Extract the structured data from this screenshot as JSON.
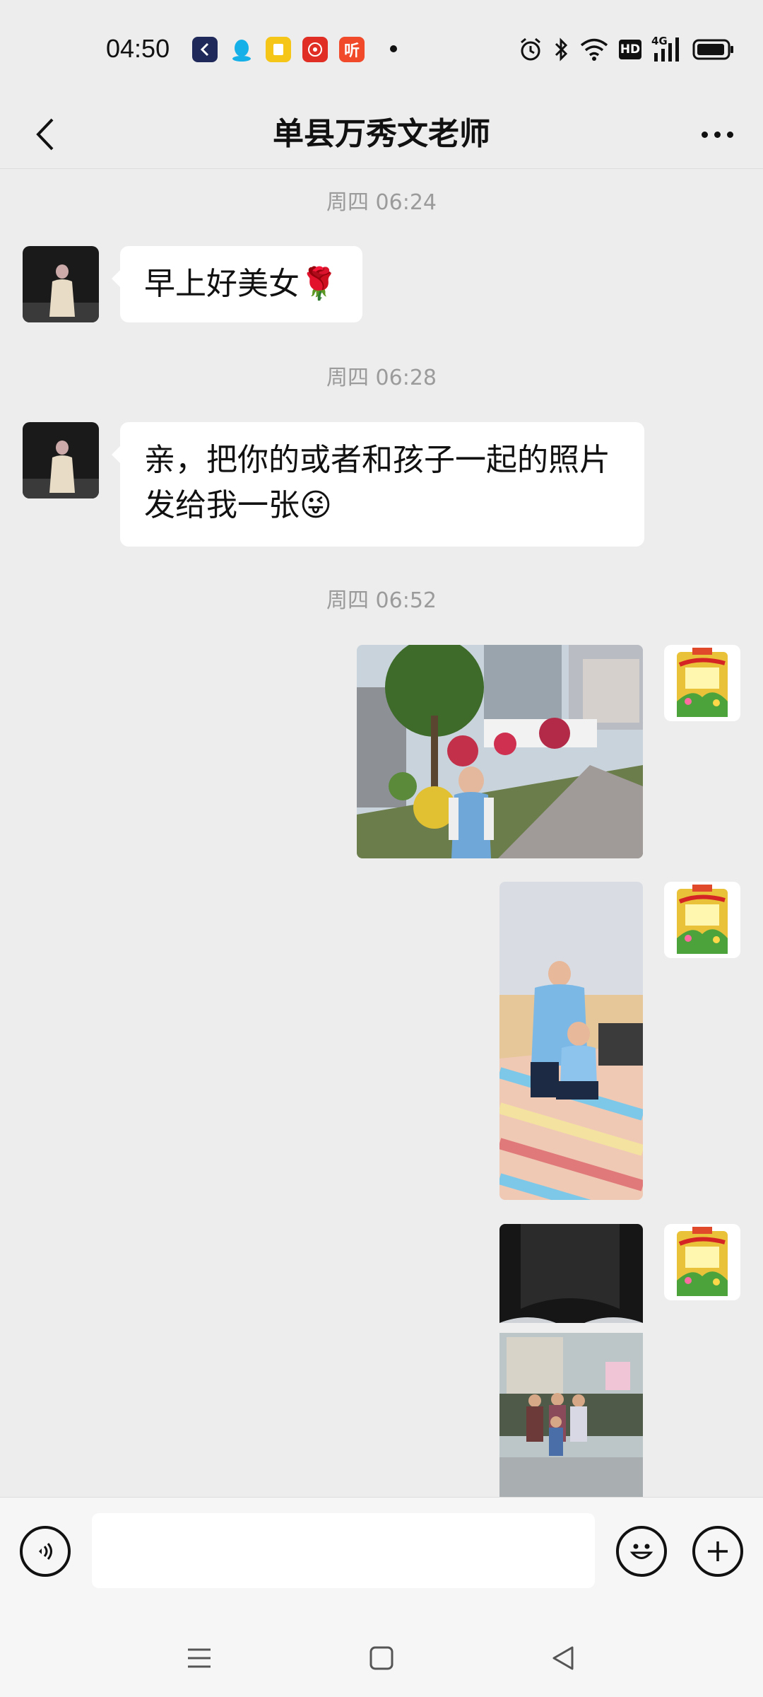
{
  "status_bar": {
    "time": "04:50",
    "notification_icons": [
      "back-app-icon",
      "qq-icon",
      "notes-app-icon",
      "pinduoduo-icon",
      "listen-app-icon"
    ],
    "listen_icon_text": "听",
    "system_icons": [
      "alarm-icon",
      "bluetooth-icon",
      "wifi-icon",
      "hd-icon",
      "4g-signal-icon",
      "battery-icon"
    ],
    "hd_text": "HD",
    "network_text": "4G"
  },
  "header": {
    "title": "单县万秀文老师"
  },
  "messages": [
    {
      "type": "time",
      "text": "周四 06:24"
    },
    {
      "type": "text",
      "side": "left",
      "text": "早上好美女🌹"
    },
    {
      "type": "time",
      "text": "周四 06:28"
    },
    {
      "type": "text",
      "side": "left",
      "text": "亲，把你的或者和孩子一起的照片发给我一张😜"
    },
    {
      "type": "time",
      "text": "周四 06:52"
    },
    {
      "type": "image",
      "side": "right",
      "description": "photo-boy-garden"
    },
    {
      "type": "image",
      "side": "right",
      "description": "photo-mother-child-bed"
    },
    {
      "type": "image",
      "side": "right",
      "description": "photo-printed-group"
    }
  ],
  "colors": {
    "background": "#ededed",
    "bubble_in": "#ffffff",
    "time_text": "#9b9b9b"
  },
  "input": {
    "placeholder": "",
    "value": ""
  }
}
